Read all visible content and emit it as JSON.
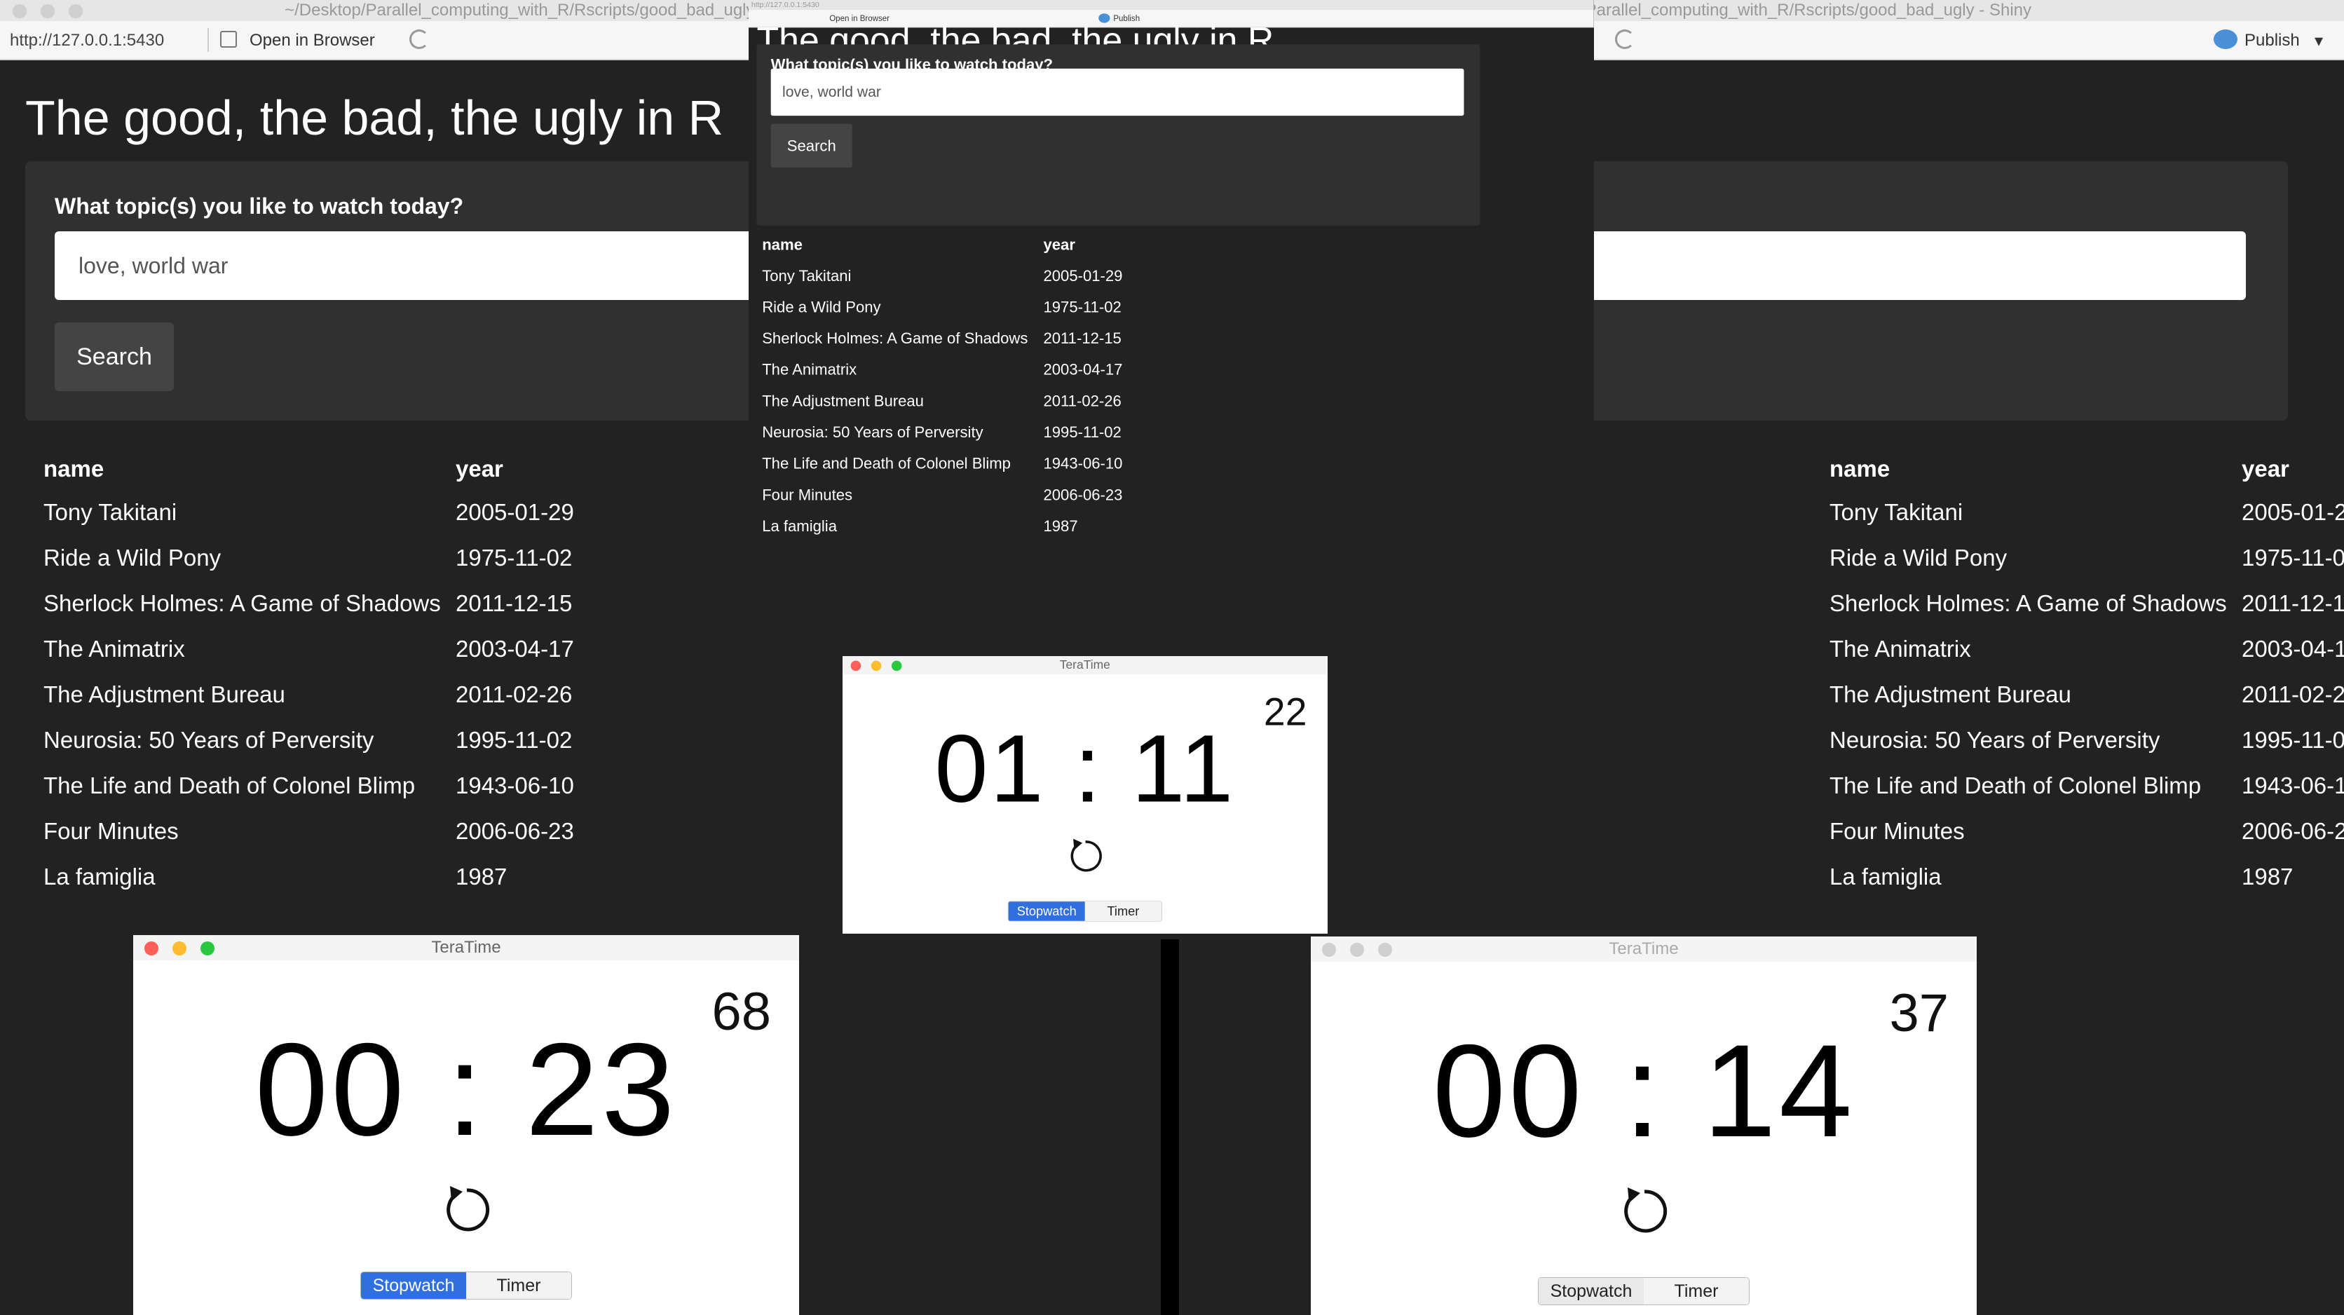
{
  "window": {
    "left_title": "~/Desktop/Parallel_computing_with_R/Rscripts/good_bad_ugly - Shiny",
    "right_title": "~/Desktop/Parallel_computing_with_R/Rscripts/good_bad_ugly - Shiny",
    "mid_title": "~/Desktop/Parallel_computing_with_R/Rscripts/good_bad_ugly - Shiny"
  },
  "toolbar": {
    "url": "http://127.0.0.1:5430",
    "open_in_browser": "Open in Browser",
    "publish": "Publish",
    "publish_arrow": "▾"
  },
  "app": {
    "title": "The good, the bad, the ugly in R",
    "question": "What topic(s) you like to watch today?",
    "input_value": "love, world war",
    "search_label": "Search",
    "columns": [
      "name",
      "year"
    ],
    "rows": [
      [
        "Tony Takitani",
        "2005-01-29"
      ],
      [
        "Ride a Wild Pony",
        "1975-11-02"
      ],
      [
        "Sherlock Holmes: A Game of Shadows",
        "2011-12-15"
      ],
      [
        "The Animatrix",
        "2003-04-17"
      ],
      [
        "The Adjustment Bureau",
        "2011-02-26"
      ],
      [
        "Neurosia: 50 Years of Perversity",
        "1995-11-02"
      ],
      [
        "The Life and Death of Colonel Blimp",
        "1943-06-10"
      ],
      [
        "Four Minutes",
        "2006-06-23"
      ],
      [
        "La famiglia",
        "1987"
      ]
    ]
  },
  "timers": {
    "left": {
      "title": "TeraTime",
      "count": "68",
      "time": "00 : 23",
      "stopwatch": "Stopwatch",
      "timer": "Timer"
    },
    "middle": {
      "title": "TeraTime",
      "count": "22",
      "time": "01 : 11",
      "stopwatch": "Stopwatch",
      "timer": "Timer"
    },
    "right": {
      "title": "TeraTime",
      "count": "37",
      "time": "00 : 14",
      "stopwatch": "Stopwatch",
      "timer": "Timer"
    }
  },
  "colors": {
    "app_bg": "#222222",
    "well_bg": "#303030",
    "segment_active": "#2f6fe0",
    "close": "#ff5f57",
    "minimize": "#febc2e",
    "zoom": "#28c840"
  },
  "icons": [
    "reset-icon",
    "open-in-browser-icon",
    "reload-icon",
    "publish-icon"
  ]
}
